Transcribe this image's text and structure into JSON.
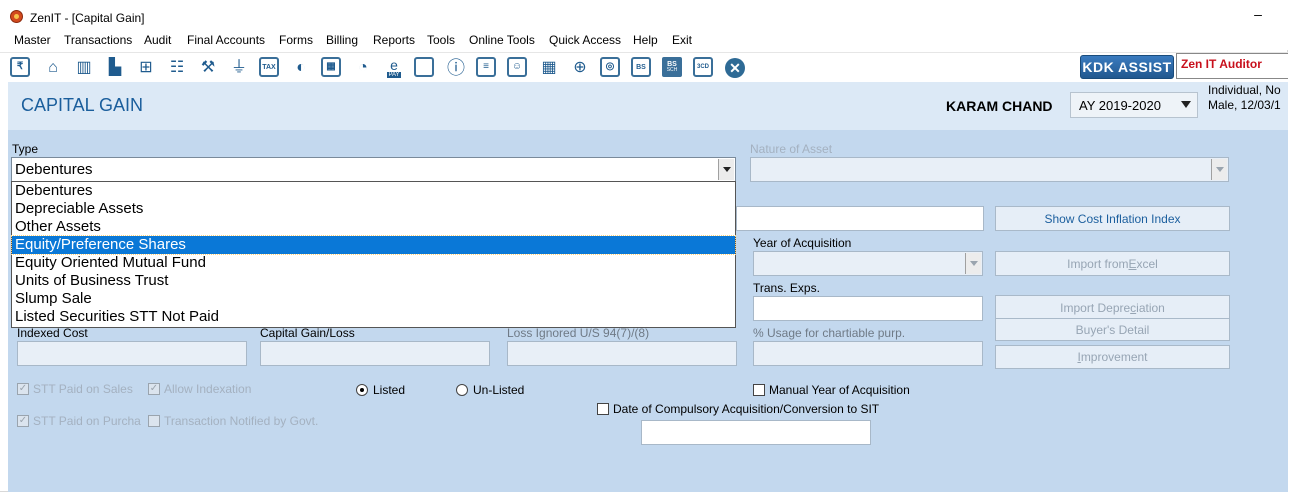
{
  "window": {
    "title": "ZenIT - [Capital Gain]",
    "minimize": "–"
  },
  "menu": [
    "Master",
    "Transactions",
    "Audit",
    "Final Accounts",
    "Forms",
    "Billing",
    "Reports",
    "Tools",
    "Online Tools",
    "Quick Access",
    "Help",
    "Exit"
  ],
  "toolbar": {
    "icons": [
      "return-icon",
      "home-icon",
      "building-icon",
      "chart-icon",
      "gift-icon",
      "users-icon",
      "gavel-icon",
      "filter-icon",
      "tax-icon",
      "refresh-icon",
      "calculator-icon",
      "pie-icon",
      "epay-icon",
      "book-icon",
      "info-icon",
      "ledger-icon",
      "report-user-icon",
      "calendar-icon",
      "folder-icon",
      "return-doc-icon",
      "bs-icon",
      "bs-sch-icon",
      "3cd-icon",
      "close-icon"
    ],
    "kdk_assist": "KDK ASSIST",
    "zen_auditor": "Zen IT Auditor",
    "labels": {
      "tax": "TAX",
      "pay": "PAY",
      "bs": "BS",
      "bs2": "BS",
      "sch": "SCH",
      "three_cd": "3CD"
    }
  },
  "header": {
    "title": "CAPITAL GAIN",
    "client_name": "KARAM CHAND",
    "assessment_year": "AY 2019-2020",
    "client_info_line1": "Individual, No",
    "client_info_line2": "Male, 12/03/1"
  },
  "form": {
    "type_label": "Type",
    "type_value": "Debentures",
    "nature_label": "Nature of Asset",
    "nature_value": "",
    "type_options": [
      "Debentures",
      "Depreciable Assets",
      "Other Assets",
      "Equity/Preference Shares",
      "Equity Oriented Mutual Fund",
      "Units of Business Trust",
      "Slump Sale",
      "Listed Securities STT Not Paid"
    ],
    "type_selected": "Equity/Preference Shares",
    "year_of_acquisition_label": "Year of Acquisition",
    "trans_exps_label": "Trans. Exps.",
    "indexed_cost_label": "Indexed Cost",
    "capital_gain_loss_label": "Capital Gain/Loss",
    "loss_ignored_label": "Loss Ignored U/S 94(7)/(8)",
    "usage_label": "% Usage for chartiable  purp.",
    "btn_show_cii": "Show Cost Inflation Index",
    "btn_import_excel_pre": "Import from ",
    "btn_import_excel_u": "E",
    "btn_import_excel_post": "xcel",
    "btn_import_depr_pre": "Import Depre",
    "btn_import_depr_u": "c",
    "btn_import_depr_post": "iation",
    "btn_buyers_detail": "Buyer's Detail",
    "btn_improvement_u": "I",
    "btn_improvement_post": "mprovement",
    "stt_paid_sales": "STT Paid on Sales",
    "allow_indexation": "Allow Indexation",
    "stt_paid_purchase": "STT Paid on Purcha",
    "transaction_notified": "Transaction Notified by Govt.",
    "radio_listed": "Listed",
    "radio_unlisted": "Un-Listed",
    "manual_year": "Manual Year of Acquisition",
    "date_compulsory": "Date of Compulsory Acquisition/Conversion to SIT",
    "show_cii_u": "I"
  }
}
